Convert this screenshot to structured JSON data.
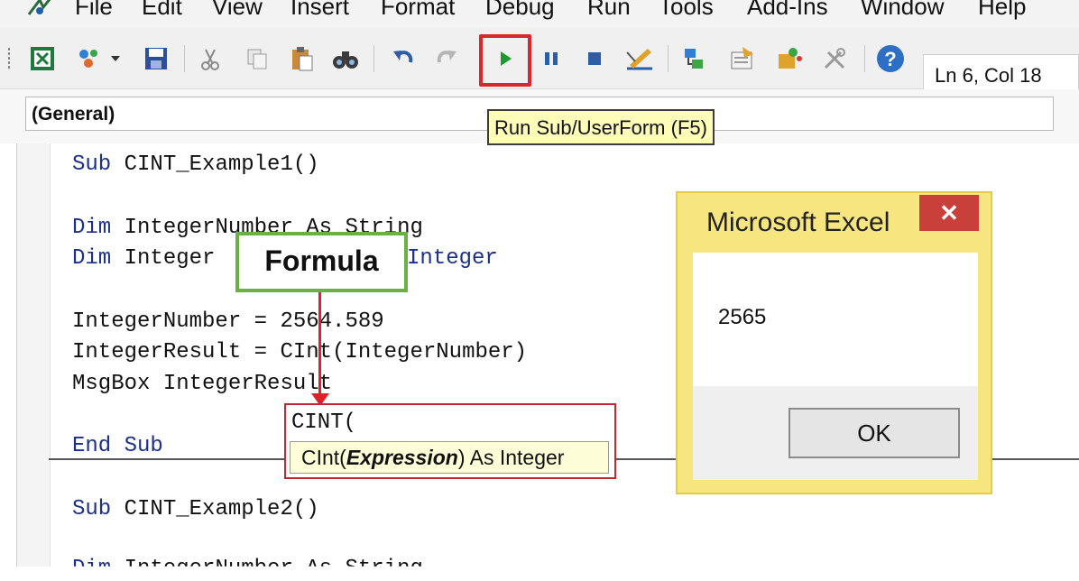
{
  "menu": {
    "items": [
      "File",
      "Edit",
      "View",
      "Insert",
      "Format",
      "Debug",
      "Run",
      "Tools",
      "Add-Ins",
      "Window",
      "Help"
    ]
  },
  "toolbar": {
    "cursor_position": "Ln 6, Col 18",
    "run_tooltip": "Run Sub/UserForm (F5)"
  },
  "object_combo": {
    "value": "(General)"
  },
  "code": {
    "sub1_keyword": "Sub",
    "sub1_name": " CINT_Example1()",
    "dim_keyword": "Dim",
    "dim1_rest": " IntegerNumber As String",
    "dim2_rest": " Integer",
    "dim2_tail": "Integer",
    "assign1": "IntegerNumber = 2564.589",
    "assign2": "IntegerResult = CInt(IntegerNumber)",
    "msgbox_line": "MsgBox IntegerResult",
    "end_sub": "End Sub",
    "sub2_keyword": "Sub",
    "sub2_name": " CINT_Example2()",
    "partial_line": "Dim IntegerNumber As String"
  },
  "callout": {
    "label": "Formula",
    "color": "#6bb044",
    "arrow_color": "#e0202a"
  },
  "intellisense": {
    "typed": "CINT(",
    "tip_prefix": "CInt(",
    "tip_param": "Expression",
    "tip_suffix": ") As Integer"
  },
  "msgbox": {
    "title": "Microsoft Excel",
    "close_label": "✕",
    "message": "2565",
    "ok_label": "OK"
  },
  "colors": {
    "keyword": "#1b2f8c",
    "run_highlight": "#d8282a",
    "tooltip_bg": "#fdfdb8",
    "msgbox_frame": "#f7e680"
  }
}
